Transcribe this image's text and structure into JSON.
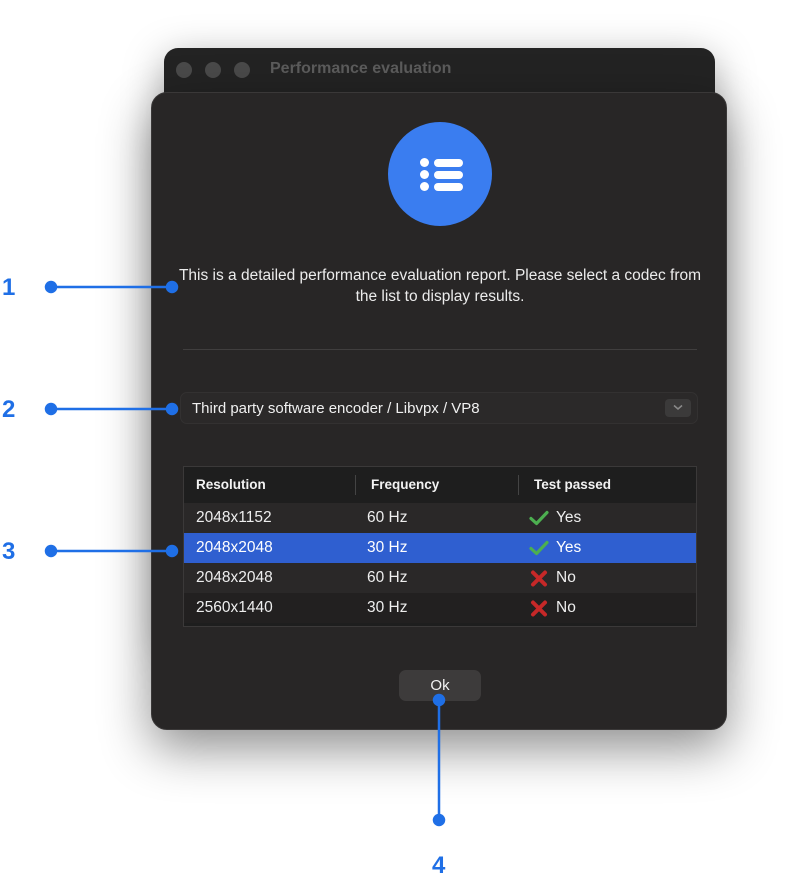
{
  "window": {
    "title": "Performance evaluation"
  },
  "app_icon": {
    "name": "list-icon",
    "color": "#3a7df0"
  },
  "description": "This is a detailed performance evaluation report. Please select a codec from the list to display results.",
  "codec_select": {
    "value": "Third party software encoder / Libvpx / VP8",
    "icon": "chevron-down-icon"
  },
  "table": {
    "headers": [
      "Resolution",
      "Frequency",
      "Test passed"
    ],
    "rows": [
      {
        "resolution": "2048x1152",
        "frequency": "60 Hz",
        "passed": "Yes",
        "icon": "check-icon",
        "selected": false
      },
      {
        "resolution": "2048x2048",
        "frequency": "30 Hz",
        "passed": "Yes",
        "icon": "check-icon",
        "selected": true
      },
      {
        "resolution": "2048x2048",
        "frequency": "60 Hz",
        "passed": "No",
        "icon": "cross-icon",
        "selected": false
      },
      {
        "resolution": "2560x1440",
        "frequency": "30 Hz",
        "passed": "No",
        "icon": "cross-icon",
        "selected": false
      }
    ]
  },
  "ok_button": {
    "label": "Ok"
  },
  "callouts": [
    "1",
    "2",
    "3",
    "4"
  ],
  "colors": {
    "accent": "#2f5fd0",
    "callout": "#1f6fe6",
    "pass": "#4caf50",
    "fail": "#c62828"
  }
}
